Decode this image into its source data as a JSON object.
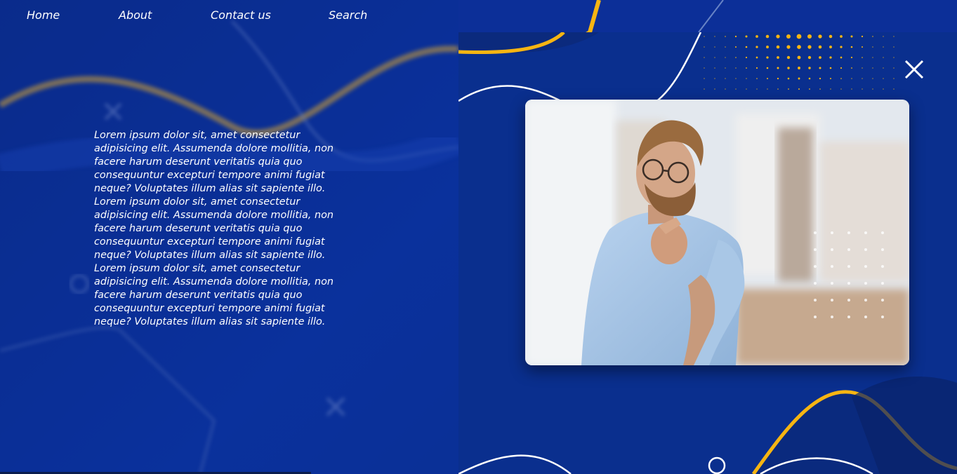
{
  "nav": {
    "items": [
      "Home",
      "About",
      "Contact us",
      "Search"
    ]
  },
  "content": {
    "paragraphs": [
      "Lorem ipsum dolor sit, amet consectetur adipisicing elit. Assumenda dolore mollitia, non facere harum deserunt veritatis quia quo consequuntur excepturi tempore animi fugiat neque? Voluptates illum alias sit sapiente illo.",
      "Lorem ipsum dolor sit, amet consectetur adipisicing elit. Assumenda dolore mollitia, non facere harum deserunt veritatis quia quo consequuntur excepturi tempore animi fugiat neque? Voluptates illum alias sit sapiente illo.",
      "Lorem ipsum dolor sit, amet consectetur adipisicing elit. Assumenda dolore mollitia, non facere harum deserunt veritatis quia quo consequuntur excepturi tempore animi fugiat neque? Voluptates illum alias sit sapiente illo."
    ]
  },
  "icons": {
    "close": "close-icon"
  },
  "colors": {
    "background": "#0a2f8e",
    "accent": "#f7b512",
    "text": "#ffffff"
  }
}
